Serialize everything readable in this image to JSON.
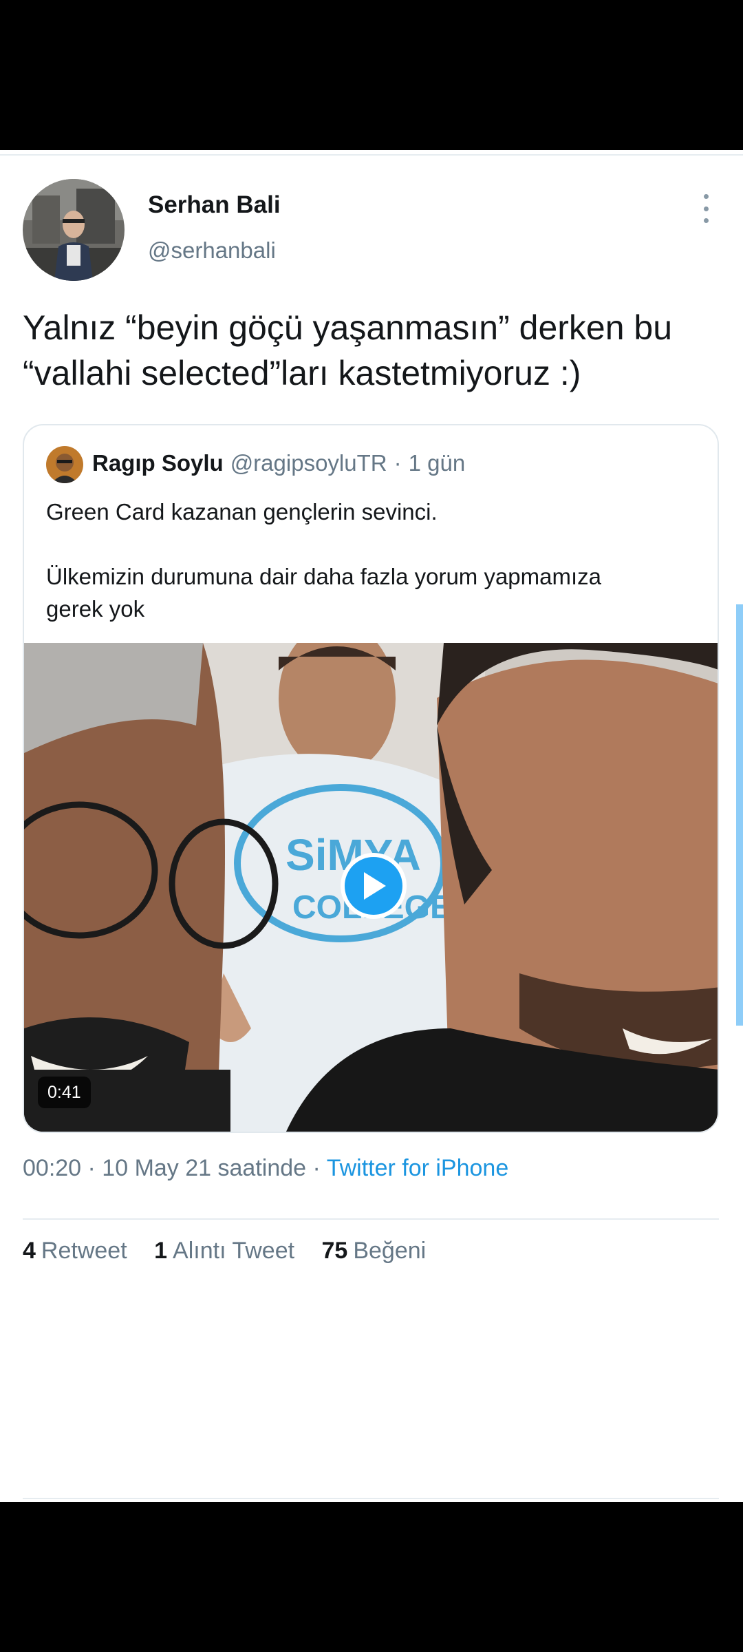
{
  "tweet": {
    "author": {
      "display_name": "Serhan Bali",
      "username": "@serhanbali"
    },
    "text_line_1": "Yalnız “beyin göçü yaşanmasın” derken bu",
    "text_line_2": "“vallahi selected”ları kastetmiyoruz :)",
    "quoted_tweet": {
      "display_name": "Ragıp Soylu",
      "username": "@ragipsoyluTR",
      "separator": "·",
      "time": "1 gün",
      "text_line_1": "Green Card kazanan gençlerin sevinci.",
      "text_line_2": "Ülkemizin durumuna dair daha fazla yorum yapmamıza",
      "text_line_3": "gerek yok",
      "video": {
        "duration": "0:41",
        "play_icon": "play-icon"
      }
    },
    "meta": {
      "time_date": "00:20 · 10 May 21 saatinde",
      "separator": "·",
      "source": "Twitter for iPhone"
    },
    "stats": {
      "retweets": {
        "count": "4",
        "label": "Retweet"
      },
      "quote_tweets": {
        "count": "1",
        "label": "Alıntı Tweet"
      },
      "likes": {
        "count": "75",
        "label": "Beğeni"
      }
    }
  },
  "icons": {
    "more": "more-vertical-icon",
    "play": "play-icon"
  },
  "colors": {
    "accent": "#1da1f2",
    "link": "#1b95e0",
    "secondary_text": "#657786",
    "primary_text": "#14171a"
  }
}
